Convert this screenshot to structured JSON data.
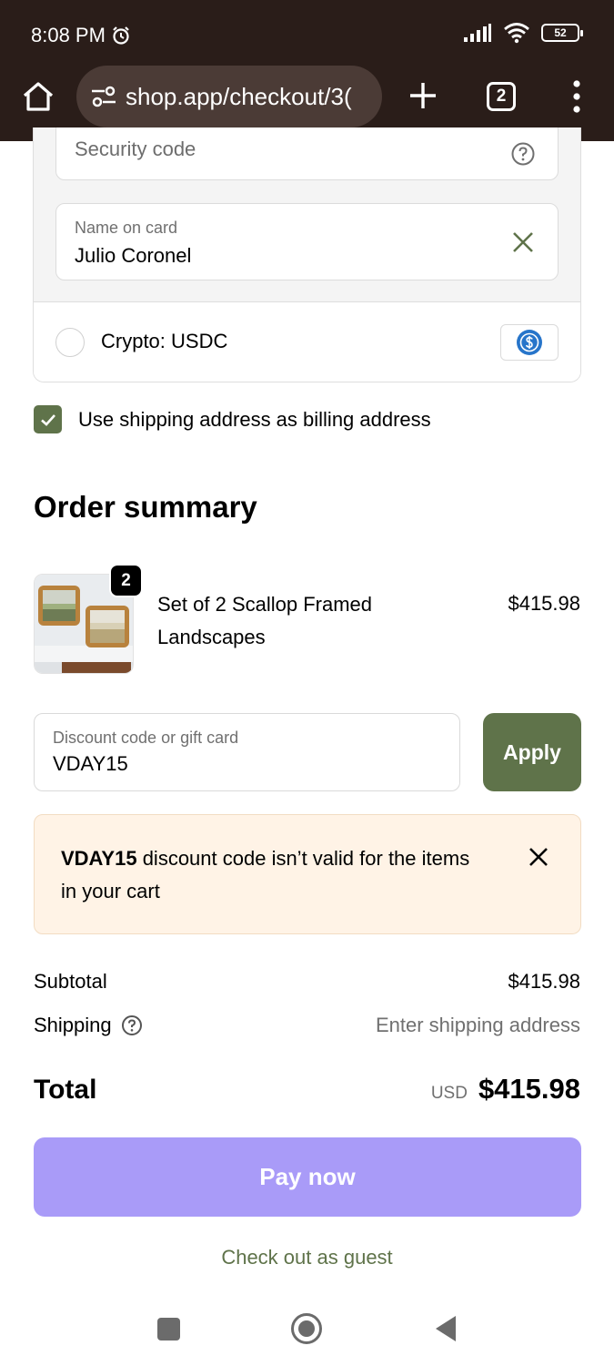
{
  "status_bar": {
    "time": "8:08 PM",
    "battery": "52"
  },
  "browser": {
    "url": "shop.app/checkout/3(",
    "tab_count": "2"
  },
  "payment": {
    "security_placeholder": "Security code",
    "name_label": "Name on card",
    "name_value": "Julio Coronel",
    "crypto_label": "Crypto: USDC"
  },
  "billing": {
    "label": "Use shipping address as billing address",
    "checked": true
  },
  "summary": {
    "title": "Order summary",
    "product": {
      "name": "Set of 2 Scallop Framed Landscapes",
      "price": "$415.98",
      "quantity": "2"
    }
  },
  "discount": {
    "label": "Discount code or gift card",
    "value": "VDAY15",
    "apply_label": "Apply"
  },
  "alert": {
    "code": "VDAY15",
    "message": " discount code isn’t valid for the items in your cart"
  },
  "totals": {
    "subtotal_label": "Subtotal",
    "subtotal_value": "$415.98",
    "shipping_label": "Shipping",
    "shipping_value": "Enter shipping address",
    "total_label": "Total",
    "currency": "USD",
    "total_value": "$415.98"
  },
  "actions": {
    "pay_label": "Pay now",
    "guest_label": "Check out as guest"
  },
  "colors": {
    "accent": "#5f734a",
    "pay_button": "#a99bf8",
    "chrome": "#2a1d19",
    "alert_bg": "#fff3e6"
  }
}
